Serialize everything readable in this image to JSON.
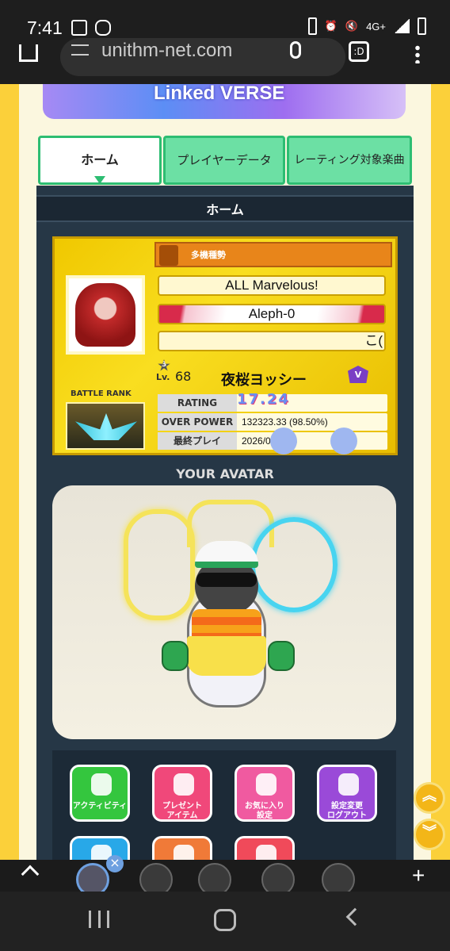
{
  "status_bar": {
    "time": "7:41",
    "network": "4G+"
  },
  "browser": {
    "url": "unithm-net.com"
  },
  "banner": {
    "text": "Linked VERSE"
  },
  "tabs": [
    {
      "label": "ホーム",
      "active": true
    },
    {
      "label": "プレイヤーデータ",
      "active": false
    },
    {
      "label": "レーティング対象楽曲",
      "active": false
    }
  ],
  "section_title": "ホーム",
  "player": {
    "team_badge": "多機種勢",
    "title_1": "ALL Marvelous!",
    "title_2": "Aleph-0",
    "title_3": "こ(",
    "battle_rank_label": "BATTLE RANK",
    "level_prefix": "Lv.",
    "level_star": "3",
    "level": "68",
    "name": "夜桜ヨッシー",
    "class_badge": "V",
    "rating_label": "RATING",
    "rating": "17.24",
    "overpower_label": "OVER POWER",
    "overpower": "132323.33 (98.50%)",
    "last_play_label": "最終プレイ",
    "last_play": "2026/0   19:34"
  },
  "avatar_title": "YOUR AVATAR",
  "app_buttons": [
    {
      "label": "アクティビティ",
      "color": "#34c63e"
    },
    {
      "label": "プレゼント\nアイテム",
      "color": "#f0487a"
    },
    {
      "label": "お気に入り\n設定",
      "color": "#f05aa0"
    },
    {
      "label": "設定変更\nログアウト",
      "color": "#9a4ad8"
    },
    {
      "label": "",
      "color": "#28a8e8"
    },
    {
      "label": "",
      "color": "#f07a38"
    },
    {
      "label": "",
      "color": "#f04a5a"
    }
  ],
  "scroll_buttons": {
    "up": "︽",
    "down": "︾"
  },
  "tab_strip": {
    "plus": "+",
    "close": "×"
  }
}
